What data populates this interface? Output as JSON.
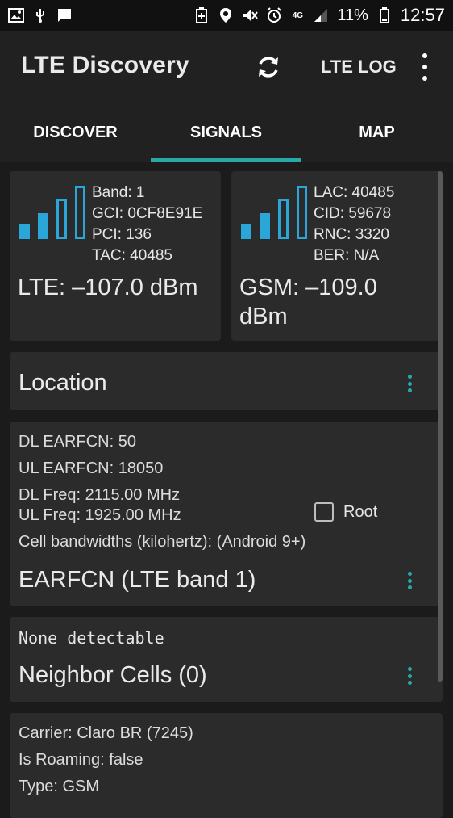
{
  "status_bar": {
    "left_icons": [
      "image-icon",
      "usb-icon",
      "message-icon"
    ],
    "right_icons": [
      "battery-saver-icon",
      "location-icon",
      "vibrate-icon",
      "alarm-icon",
      "4g-icon",
      "signal-icon"
    ],
    "network_type": "4G",
    "battery": "11%",
    "time": "12:57"
  },
  "app_bar": {
    "title": "LTE Discovery",
    "lte_log": "LTE LOG"
  },
  "tabs": [
    {
      "label": "DISCOVER"
    },
    {
      "label": "SIGNALS"
    },
    {
      "label": "MAP"
    }
  ],
  "lte_card": {
    "band": "Band: 1",
    "gci": "GCI: 0CF8E91E",
    "pci": "PCI: 136",
    "tac": "TAC: 40485",
    "signal": "LTE: –107.0 dBm"
  },
  "gsm_card": {
    "lac": "LAC: 40485",
    "cid": "CID: 59678",
    "rnc": "RNC: 3320",
    "ber": "BER: N/A",
    "signal": "GSM: –109.0 dBm"
  },
  "location": {
    "title": "Location"
  },
  "earfcn": {
    "dl_earfcn": "DL EARFCN: 50",
    "ul_earfcn": "UL EARFCN: 18050",
    "dl_freq": "DL Freq: 2115.00 MHz",
    "ul_freq": "UL Freq: 1925.00 MHz",
    "bandwidths": "Cell bandwidths (kilohertz): (Android 9+)",
    "root_label": "Root",
    "root_checked": false,
    "title": "EARFCN (LTE band 1)"
  },
  "neighbors": {
    "status": "None detectable",
    "title": "Neighbor Cells (0)"
  },
  "carrier": {
    "carrier": "Carrier: Claro BR (7245)",
    "roaming": "Is Roaming: false",
    "type": "Type: GSM"
  },
  "colors": {
    "accent": "#2aa7a7",
    "signal_blue": "#2aa7d8",
    "card_bg": "#2b2b2b",
    "bg": "#1b1b1b",
    "bar_bg": "#212121"
  }
}
